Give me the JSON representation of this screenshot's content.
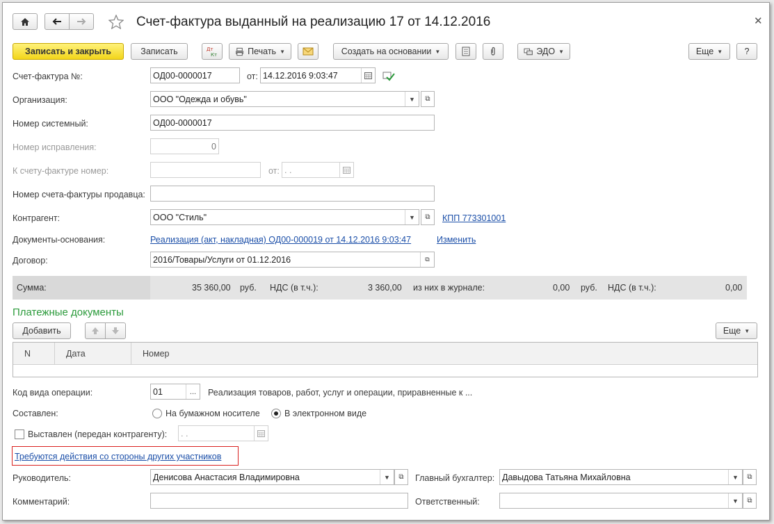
{
  "window": {
    "title": "Счет-фактура выданный на реализацию 17 от 14.12.2016"
  },
  "toolbar": {
    "save_close": "Записать и закрыть",
    "save": "Записать",
    "print": "Печать",
    "create_based": "Создать на основании",
    "edo": "ЭДО",
    "more": "Еще",
    "help": "?"
  },
  "form": {
    "invoice_number_label": "Счет-фактура №:",
    "invoice_number": "ОД00-0000017",
    "date_label": "от:",
    "date": "14.12.2016  9:03:47",
    "org_label": "Организация:",
    "org": "ООО \"Одежда и обувь\"",
    "sys_number_label": "Номер системный:",
    "sys_number": "ОД00-0000017",
    "correction_label": "Номер исправления:",
    "correction": "0",
    "to_invoice_label": "К счету-фактуре номер:",
    "to_invoice": "",
    "to_invoice_date_label": "от:",
    "to_invoice_date": " .  .",
    "seller_number_label": "Номер счета-фактуры продавца:",
    "seller_number": "",
    "counterparty_label": "Контрагент:",
    "counterparty": "ООО \"Стиль\"",
    "kpp_link": "КПП 773301001",
    "base_docs_label": "Документы-основания:",
    "base_docs_link": "Реализация (акт, накладная) ОД00-000019 от 14.12.2016 9:03:47",
    "change_link": "Изменить",
    "contract_label": "Договор:",
    "contract": "2016/Товары/Услуги от 01.12.2016"
  },
  "summary": {
    "sum_label": "Сумма:",
    "sum": "35 360,00",
    "currency": "руб.",
    "vat_label": "НДС (в т.ч.):",
    "vat": "3 360,00",
    "journal_label": "из них в журнале:",
    "journal_sum": "0,00",
    "journal_currency": "руб.",
    "journal_vat_label": "НДС (в т.ч.):",
    "journal_vat": "0,00"
  },
  "payments": {
    "section_title": "Платежные документы",
    "add_button": "Добавить",
    "more": "Еще",
    "columns": [
      "N",
      "Дата",
      "Номер"
    ]
  },
  "operation": {
    "code_label": "Код вида операции:",
    "code": "01",
    "code_btn": "...",
    "description": "Реализация товаров, работ, услуг и операции, приравненные к ...",
    "composed_label": "Составлен:",
    "paper": "На бумажном носителе",
    "electronic": "В электронном виде",
    "issued_label": "Выставлен (передан контрагенту):",
    "issued_date": " .  .",
    "action_link": "Требуются действия со стороны других участников"
  },
  "footer": {
    "head_label": "Руководитель:",
    "head": "Денисова Анастасия Владимировна",
    "accountant_label": "Главный бухгалтер:",
    "accountant": "Давыдова Татьяна Михайловна",
    "comment_label": "Комментарий:",
    "comment": "",
    "responsible_label": "Ответственный:",
    "responsible": ""
  },
  "icons": {
    "home": "home-icon",
    "back": "arrow-left-icon",
    "forward": "arrow-right-icon",
    "star": "star-icon",
    "close": "close-icon",
    "dtkt": "dt-kt-icon",
    "printer": "printer-icon",
    "mail": "envelope-icon",
    "doc": "document-icon",
    "attach": "paperclip-icon",
    "edo": "edo-icon",
    "calendar": "calendar-icon",
    "open": "open-form-icon",
    "up": "arrow-up-icon",
    "down": "arrow-down-icon"
  },
  "colors": {
    "primary_button": "#f2d51a",
    "section_title": "#2a9a3a",
    "link": "#1a4ea8",
    "highlight_box": "#d9201e"
  }
}
